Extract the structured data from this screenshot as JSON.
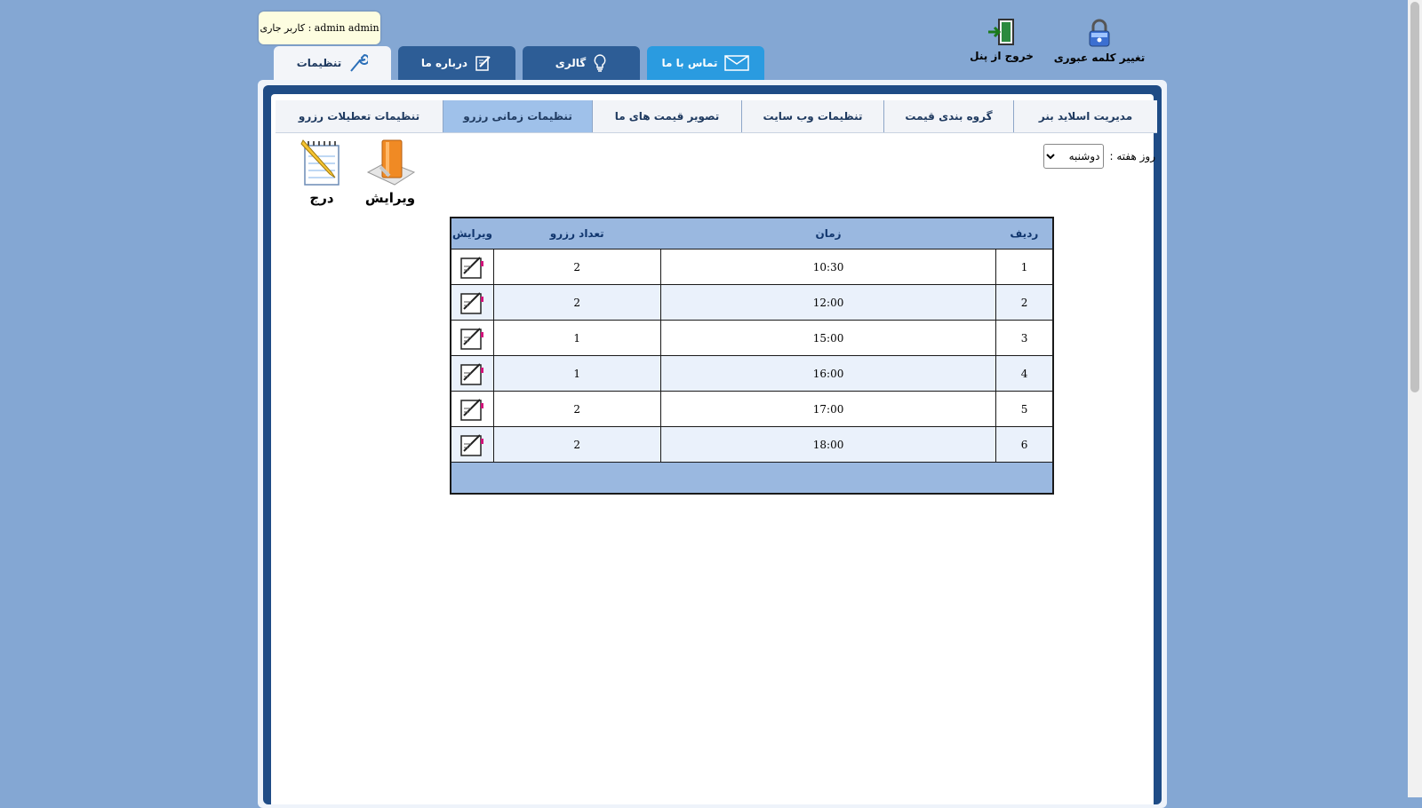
{
  "current_user": "admin admin : کاربر جاری",
  "quick_actions": {
    "change_password": "تغییر کلمه عبوری",
    "logout": "خروج از پنل"
  },
  "main_tabs": {
    "settings": "تنظیمات",
    "about": "درباره ما",
    "gallery": "گالری",
    "contact": "تماس با ما"
  },
  "sub_tabs": [
    "مدیریت اسلاید بنر",
    "گروه بندی قیمت",
    "تنظیمات وب سایت",
    "تصویر قیمت های ما",
    "تنظیمات زمانی رزرو",
    "تنظیمات تعطیلات رزرو"
  ],
  "weekday": {
    "label": "روز هفته :",
    "selected": "دوشنبه"
  },
  "actions": {
    "edit": "ویرایش",
    "insert": "درج"
  },
  "table": {
    "headers": {
      "row": "ردیف",
      "time": "زمان",
      "count": "تعداد رزرو",
      "edit": "ویرایش"
    },
    "rows": [
      {
        "row": "1",
        "time": "10:30",
        "count": "2"
      },
      {
        "row": "2",
        "time": "12:00",
        "count": "2"
      },
      {
        "row": "3",
        "time": "15:00",
        "count": "1"
      },
      {
        "row": "4",
        "time": "16:00",
        "count": "1"
      },
      {
        "row": "5",
        "time": "17:00",
        "count": "2"
      },
      {
        "row": "6",
        "time": "18:00",
        "count": "2"
      }
    ]
  },
  "colors": {
    "background": "#84a7d3",
    "tab_dark": "#2d5d96",
    "tab_light": "#2a9be0",
    "header_blue": "#9ab8e0",
    "active_subtab": "#9fc1ea"
  }
}
